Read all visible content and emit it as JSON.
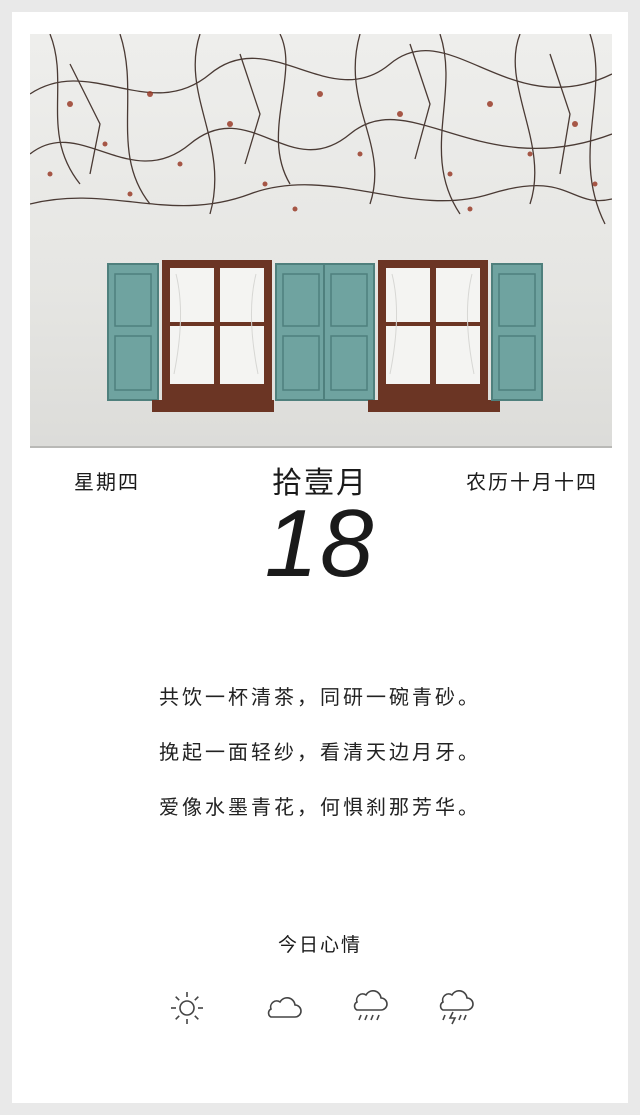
{
  "header": {
    "weekday": "星期四",
    "month": "拾壹月",
    "lunar_date": "农历十月十四"
  },
  "day_number": "18",
  "poem": {
    "lines": [
      "共饮一杯清茶，同研一碗青砂。",
      "挽起一面轻纱，看清天边月牙。",
      "爱像水墨青花，何惧刹那芳华。"
    ]
  },
  "mood": {
    "title": "今日心情",
    "icons": [
      "sun-icon",
      "cloud-icon",
      "rain-cloud-icon",
      "thunderstorm-icon"
    ]
  },
  "colors": {
    "shutter": "#6fa3a0",
    "frame": "#6b3524",
    "wall": "#ebebe8",
    "vine": "#4a3a34"
  }
}
